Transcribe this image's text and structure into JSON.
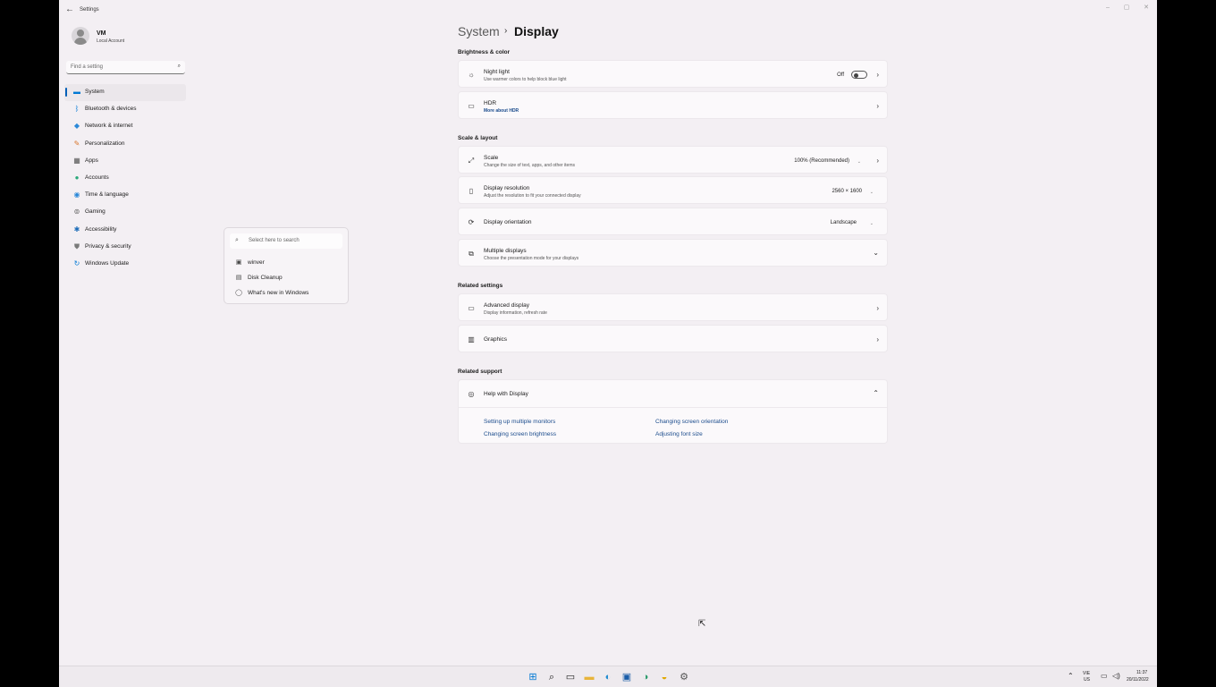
{
  "window": {
    "title": "Settings",
    "controls": {
      "minimize": "–",
      "maximize": "▢",
      "close": "✕"
    }
  },
  "user": {
    "name": "VM",
    "account_type": "Local Account"
  },
  "find": {
    "placeholder": "Find a setting"
  },
  "sidebar": {
    "items": [
      {
        "label": "System",
        "icon": "monitor-icon",
        "glyph": "▬",
        "color": "#0078d4",
        "active": true
      },
      {
        "label": "Bluetooth & devices",
        "icon": "bluetooth-icon",
        "glyph": "ᛒ",
        "color": "#0078d4"
      },
      {
        "label": "Network & internet",
        "icon": "wifi-icon",
        "glyph": "◆",
        "color": "#2b88d8"
      },
      {
        "label": "Personalization",
        "icon": "brush-icon",
        "glyph": "✎",
        "color": "#d8752b"
      },
      {
        "label": "Apps",
        "icon": "apps-icon",
        "glyph": "▦",
        "color": "#555555"
      },
      {
        "label": "Accounts",
        "icon": "person-icon",
        "glyph": "●",
        "color": "#2aa87a"
      },
      {
        "label": "Time & language",
        "icon": "globe-clock-icon",
        "glyph": "◉",
        "color": "#2b88d8"
      },
      {
        "label": "Gaming",
        "icon": "gamepad-icon",
        "glyph": "⊚",
        "color": "#666666"
      },
      {
        "label": "Accessibility",
        "icon": "accessibility-icon",
        "glyph": "✱",
        "color": "#1a6bb8"
      },
      {
        "label": "Privacy & security",
        "icon": "shield-icon",
        "glyph": "⛊",
        "color": "#7a7a7a"
      },
      {
        "label": "Windows Update",
        "icon": "update-icon",
        "glyph": "↻",
        "color": "#0078d4"
      }
    ]
  },
  "popup": {
    "search_placeholder": "Select here to search",
    "items": [
      {
        "label": "winver",
        "icon": "app-icon",
        "glyph": "▣"
      },
      {
        "label": "Disk Cleanup",
        "icon": "disk-icon",
        "glyph": "▤"
      },
      {
        "label": "What's new in Windows",
        "icon": "lightbulb-icon",
        "glyph": "◯"
      }
    ]
  },
  "breadcrumb": {
    "parent": "System",
    "separator": "›",
    "current": "Display"
  },
  "sections": {
    "brightness": "Brightness & color",
    "scale_layout": "Scale & layout",
    "related_settings": "Related settings",
    "related_support": "Related support"
  },
  "cards": {
    "night_light": {
      "title": "Night light",
      "sub": "Use warmer colors to help block blue light",
      "state": "Off",
      "on": false
    },
    "hdr": {
      "title": "HDR",
      "sub": "More about HDR"
    },
    "scale": {
      "title": "Scale",
      "sub": "Change the size of text, apps, and other items",
      "value": "100% (Recommended)"
    },
    "resolution": {
      "title": "Display resolution",
      "sub": "Adjust the resolution to fit your connected display",
      "value": "2560 × 1600"
    },
    "orientation": {
      "title": "Display orientation",
      "value": "Landscape"
    },
    "multiple": {
      "title": "Multiple displays",
      "sub": "Choose the presentation mode for your displays"
    },
    "advanced": {
      "title": "Advanced display",
      "sub": "Display information, refresh rate"
    },
    "graphics": {
      "title": "Graphics"
    },
    "help": {
      "title": "Help with Display",
      "links": [
        "Setting up multiple monitors",
        "Changing screen orientation",
        "Changing screen brightness",
        "Adjusting font size"
      ]
    }
  },
  "taskbar": {
    "icons": [
      {
        "name": "start-icon",
        "glyph": "⊞",
        "color": "#0078d4"
      },
      {
        "name": "search-icon",
        "glyph": "⌕",
        "color": "#222222"
      },
      {
        "name": "task-view-icon",
        "glyph": "▭",
        "color": "#222222"
      },
      {
        "name": "file-explorer-icon",
        "glyph": "▬",
        "color": "#e8b43a"
      },
      {
        "name": "edge-icon",
        "glyph": "◐",
        "color": "#1f8bd0"
      },
      {
        "name": "store-icon",
        "glyph": "▣",
        "color": "#1a5da8"
      },
      {
        "name": "edge-dev-icon",
        "glyph": "◑",
        "color": "#2a9b6a"
      },
      {
        "name": "edge-canary-icon",
        "glyph": "◒",
        "color": "#e0a800"
      },
      {
        "name": "settings-icon",
        "glyph": "⚙",
        "color": "#555555"
      }
    ],
    "lang_top": "VIE",
    "lang_bottom": "US",
    "time": "11:37",
    "date": "20/11/2022"
  }
}
